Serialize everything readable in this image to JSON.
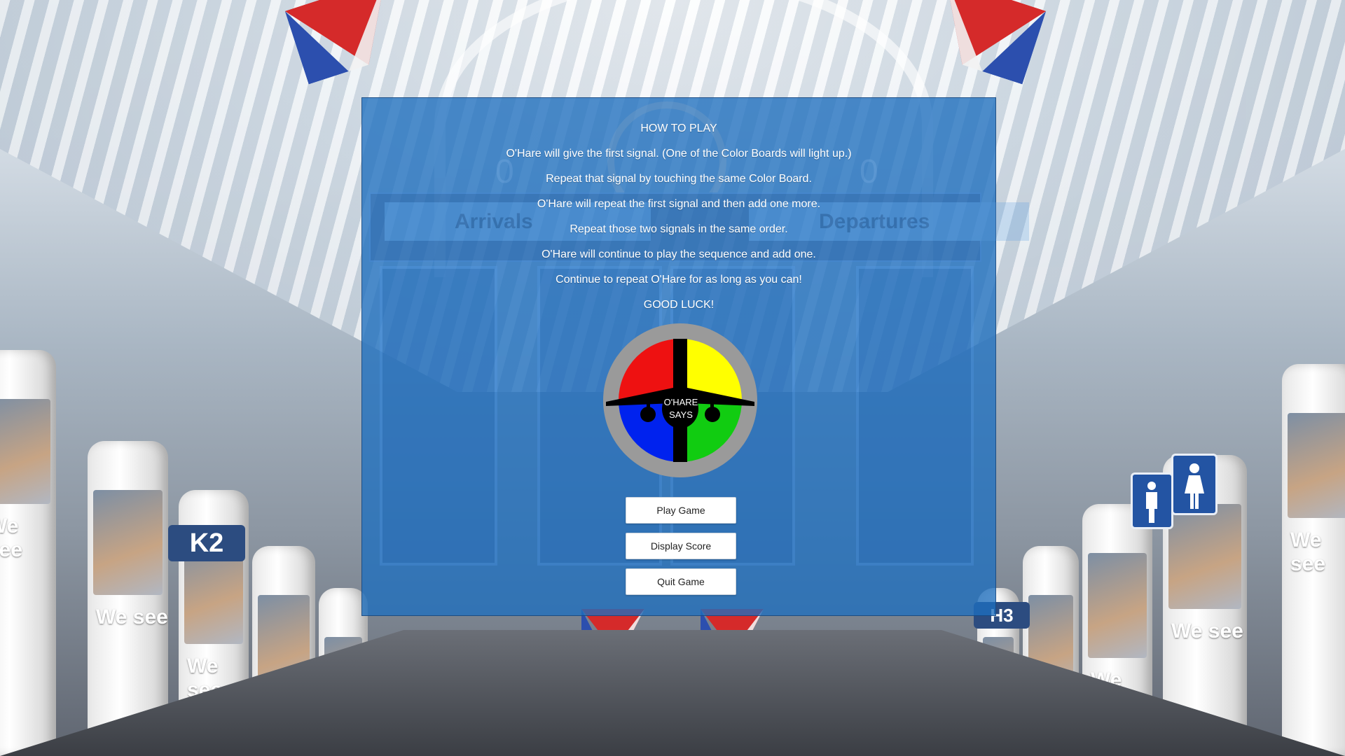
{
  "how_to_play": {
    "title": "HOW TO PLAY",
    "lines": [
      "O'Hare will give the first signal. (One of the Color Boards will light up.)",
      "Repeat that signal by touching the same Color Board.",
      "O'Hare will repeat the first signal and then add one more.",
      "Repeat those two signals in the same order.",
      "O'Hare will continue to play the sequence and add one.",
      "Continue to repeat O'Hare for as long as you can!",
      "GOOD LUCK!"
    ]
  },
  "logo": {
    "line1": "O'HARE",
    "line2": "SAYS",
    "quadrant_colors": {
      "top_left": "#ee1111",
      "top_right": "#ffff00",
      "bottom_left": "#0022ee",
      "bottom_right": "#11cc11"
    },
    "ring_color": "#9a9a9a"
  },
  "buttons": {
    "play": "Play Game",
    "score": "Display Score",
    "quit": "Quit Game"
  },
  "background": {
    "board_left": "Arrivals",
    "board_right": "Departures",
    "score_left": "0",
    "score_right": "0",
    "gate_signs": [
      "K2",
      "H3"
    ],
    "poster_text": "We see"
  },
  "colors": {
    "panel": "#1e6ebe",
    "button_bg": "#ffffff",
    "text": "#ffffff"
  }
}
